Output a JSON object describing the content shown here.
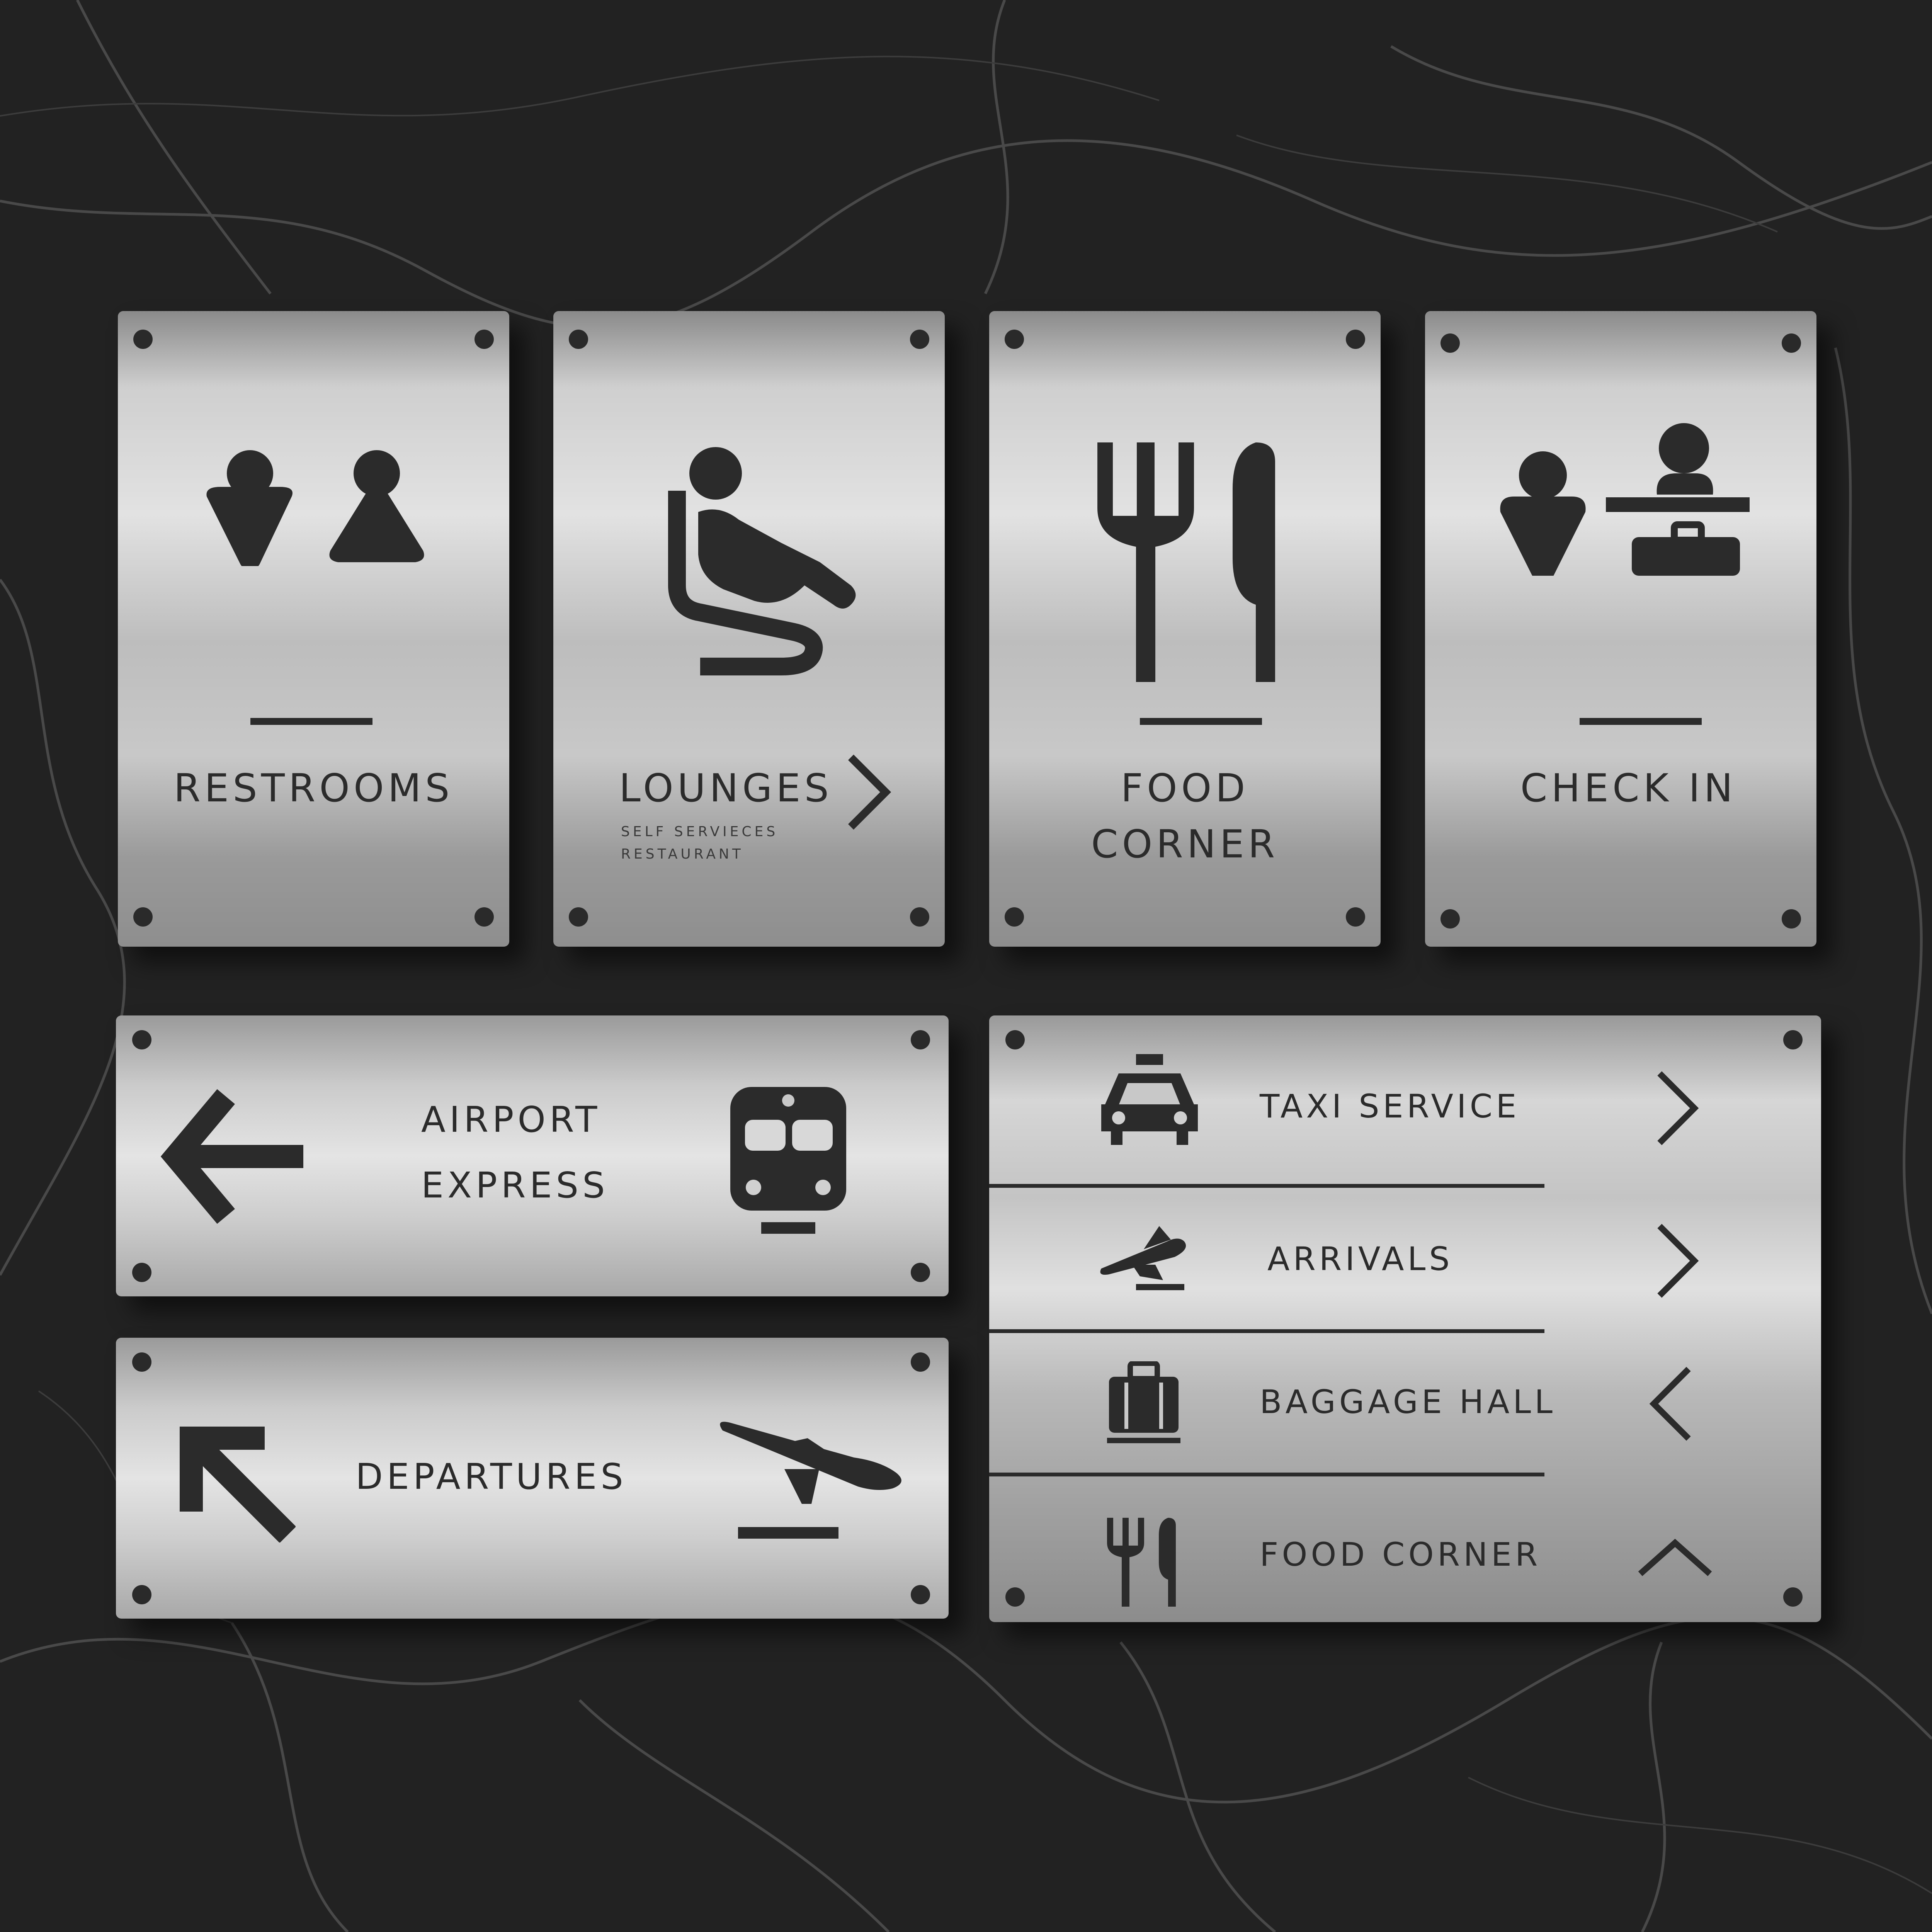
{
  "background_color": "#222222",
  "plate_color": "#c8c8c8",
  "ink_color": "#2b2b2b",
  "signs": {
    "restrooms": {
      "title": "RESTROOMS",
      "icon": "restroom-icon"
    },
    "lounges": {
      "title": "LOUNGES",
      "sub_1": "SELF SERVIECES",
      "sub_2": "RESTAURANT",
      "icon": "lounge-seat-icon",
      "arrow": "chevron-right-icon"
    },
    "food": {
      "title_1": "FOOD",
      "title_2": "CORNER",
      "icon": "fork-knife-icon"
    },
    "checkin": {
      "title": "CHECK IN",
      "icon": "check-in-icon"
    },
    "airport_express": {
      "title_1": "AIRPORT",
      "title_2": "EXPRESS",
      "icon": "train-icon",
      "arrow": "arrow-left-icon"
    },
    "departures": {
      "title": "DEPARTURES",
      "icon": "departure-plane-icon",
      "arrow": "arrow-up-left-icon"
    },
    "directory": {
      "rows": [
        {
          "label": "TAXI SERVICE",
          "icon": "taxi-icon",
          "arrow": "chevron-right-icon"
        },
        {
          "label": "ARRIVALS",
          "icon": "arrival-plane-icon",
          "arrow": "chevron-right-icon"
        },
        {
          "label": "BAGGAGE HALL",
          "icon": "baggage-icon",
          "arrow": "chevron-left-icon"
        },
        {
          "label": "FOOD CORNER",
          "icon": "fork-knife-icon",
          "arrow": "chevron-up-icon"
        }
      ]
    }
  }
}
